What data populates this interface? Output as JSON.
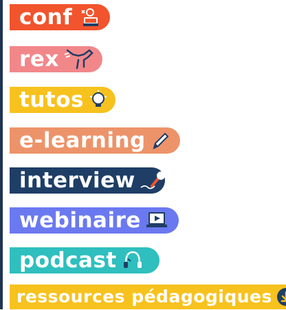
{
  "tags": [
    {
      "key": "conf",
      "label": "conf",
      "icon": "speaker-at-podium-icon",
      "color": "#f2542d"
    },
    {
      "key": "rex",
      "label": "rex",
      "icon": "dinosaur-icon",
      "color": "#f2878a"
    },
    {
      "key": "tutos",
      "label": "tutos",
      "icon": "lightbulb-icon",
      "color": "#f7c21e"
    },
    {
      "key": "elearning",
      "label": "e-learning",
      "icon": "pencil-icon",
      "color": "#ed936a"
    },
    {
      "key": "interview",
      "label": "interview",
      "icon": "microphone-icon",
      "color": "#1f3e66"
    },
    {
      "key": "webinaire",
      "label": "webinaire",
      "icon": "laptop-play-icon",
      "color": "#6b79f0"
    },
    {
      "key": "podcast",
      "label": "podcast",
      "icon": "headphones-icon",
      "color": "#2ebfbe"
    },
    {
      "key": "ressources",
      "label": "ressources pédagogiques",
      "icon": "download-icon",
      "color": "#f7c21e"
    }
  ],
  "colors": {
    "edge": "#1f3354",
    "icon_dark": "#1f3e66"
  }
}
